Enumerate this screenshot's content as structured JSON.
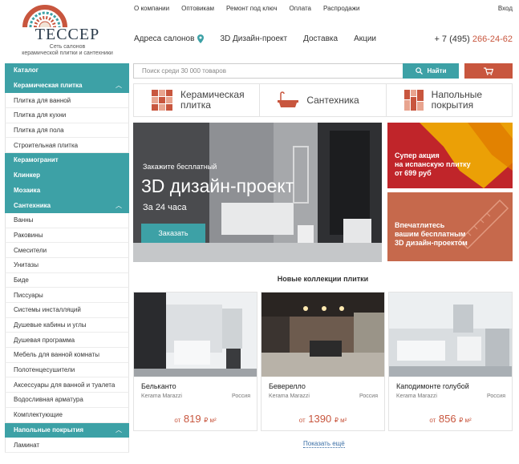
{
  "brand": {
    "name": "ТЕССЕР",
    "tagline_line1": "Сеть салонов",
    "tagline_line2": "керамической плитки и сантехники"
  },
  "topnav": [
    "О компании",
    "Оптовикам",
    "Ремонт под ключ",
    "Оплата",
    "Распродажи"
  ],
  "login": "Вход",
  "mainnav": {
    "salons": "Адреса салонов",
    "design": "3D Дизайн-проект",
    "delivery": "Доставка",
    "sales": "Акции"
  },
  "phone": {
    "prefix": "+ 7 (495)",
    "number": "266-24-62"
  },
  "sidebar": {
    "catalog": "Каталог",
    "ceramic": "Керамическая плитка",
    "ceramic_items": [
      "Плитка для ванной",
      "Плитка для кухни",
      "Плитка для пола",
      "Строительная плитка"
    ],
    "granite": "Керамогранит",
    "clinker": "Клинкер",
    "mosaic": "Мозаика",
    "plumbing": "Сантехника",
    "plumbing_items": [
      "Ванны",
      "Раковины",
      "Смесители",
      "Унитазы",
      "Биде",
      "Писсуары",
      "Системы инсталляций",
      "Душевые кабины и углы",
      "Душевая программа",
      "Мебель для ванной комнаты",
      "Полотенцесушители",
      "Аксессуары для ванной и туалета",
      "Водосливная арматура",
      "Комплектующие"
    ],
    "floors": "Напольные покрытия",
    "floors_items": [
      "Ламинат"
    ]
  },
  "search": {
    "placeholder": "Поиск среди 30 000 товаров",
    "button": "Найти"
  },
  "categories": [
    {
      "line1": "Керамическая",
      "line2": "плитка"
    },
    {
      "line1": "Сантехника",
      "line2": ""
    },
    {
      "line1": "Напольные",
      "line2": "покрытия"
    }
  ],
  "banner": {
    "small": "Закажите бесплатный",
    "big": "3D дизайн-проект",
    "sub": "За 24 часа",
    "button": "Заказать"
  },
  "promo1": {
    "l1": "Супер акция",
    "l2": "на испанскую плитку",
    "l3": "от 699 руб"
  },
  "promo2": {
    "l1": "Впечатлитесь",
    "l2": "вашим бесплатным",
    "l3": "3D дизайн-проектом"
  },
  "collections_title": "Новые коллекции плитки",
  "collections": [
    {
      "name": "Бельканто",
      "brand": "Kerama Marazzi",
      "country": "Россия",
      "price_prefix": "от",
      "price": "819",
      "unit": "₽ м²"
    },
    {
      "name": "Беверелло",
      "brand": "Kerama Marazzi",
      "country": "Россия",
      "price_prefix": "от",
      "price": "1390",
      "unit": "₽ м²"
    },
    {
      "name": "Каподимонте голубой",
      "brand": "Kerama Marazzi",
      "country": "Россия",
      "price_prefix": "от",
      "price": "856",
      "unit": "₽ м²"
    }
  ],
  "show_more": "Показать ещё",
  "colors": {
    "accent": "#3da1a6",
    "brand_red": "#c8563e",
    "promo_red": "#c0252a"
  },
  "icons": [
    "map-pin-icon",
    "search-icon",
    "cart-icon",
    "tile-icon",
    "bathtub-icon",
    "flooring-icon"
  ]
}
